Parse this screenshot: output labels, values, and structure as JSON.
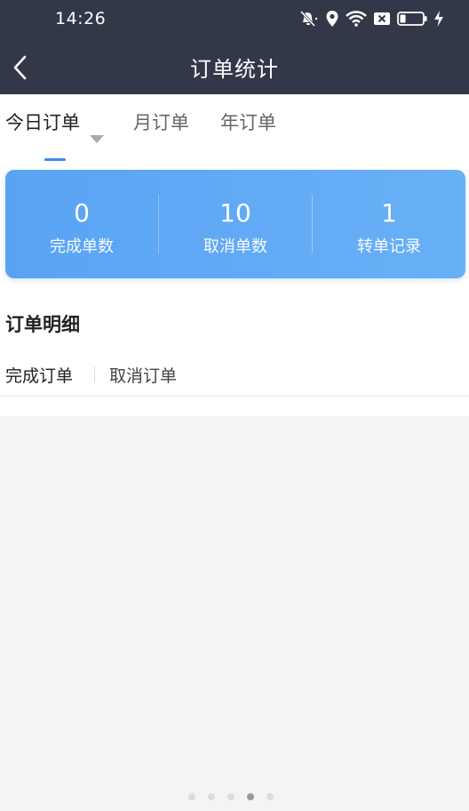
{
  "status_bar": {
    "time": "14:26",
    "icons": [
      "mute-icon",
      "location-icon",
      "wifi-icon",
      "sim-x-icon",
      "battery-icon",
      "charging-icon"
    ]
  },
  "navbar": {
    "title": "订单统计",
    "back_icon": "back-chevron-icon"
  },
  "tabs": {
    "items": [
      {
        "label": "今日订单",
        "active": true,
        "has_dropdown": true
      },
      {
        "label": "月订单",
        "active": false
      },
      {
        "label": "年订单",
        "active": false
      }
    ]
  },
  "stats": [
    {
      "value": "0",
      "label": "完成单数"
    },
    {
      "value": "10",
      "label": "取消单数"
    },
    {
      "value": "1",
      "label": "转单记录"
    }
  ],
  "detail": {
    "title": "订单明细",
    "subtabs": [
      {
        "label": "完成订单",
        "active": true
      },
      {
        "label": "取消订单",
        "active": false
      }
    ]
  },
  "pager": {
    "count": 5,
    "active_index": 3
  },
  "colors": {
    "header_bg": "#333849",
    "accent": "#3b8cf0",
    "card_bg": "#5aa3f4",
    "page_bg": "#f4f4f4"
  }
}
